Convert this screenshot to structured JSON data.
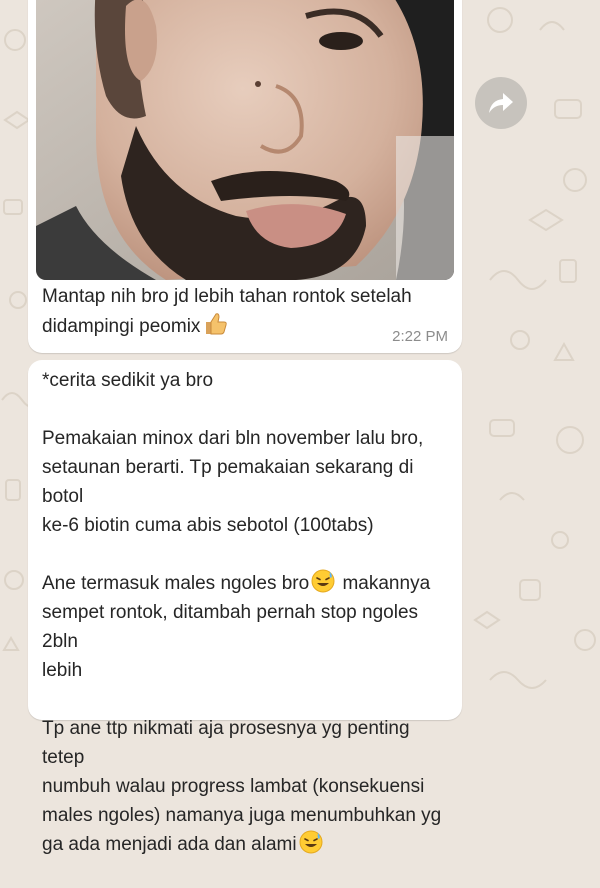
{
  "chat": {
    "wallpaper_color": "#ECE5DD",
    "messages": [
      {
        "type": "image",
        "caption_lines": [
          "Mantap nih bro jd lebih tahan rontok setelah",
          "didampingi peomix"
        ],
        "caption_emoji": "thumbs-up-icon",
        "time": "2:22 PM"
      },
      {
        "type": "text",
        "paragraphs": [
          {
            "lines": [
              "*cerita sedikit ya bro"
            ]
          },
          {
            "lines": [
              "Pemakaian minox dari bln november lalu bro,",
              "setaunan berarti. Tp pemakaian sekarang di botol",
              "ke-6 biotin cuma abis sebotol (100tabs)"
            ]
          },
          {
            "lines": [
              "Ane termasuk males ngoles bro",
              "sempet rontok, ditambah pernah stop ngoles 2bln",
              "lebih"
            ],
            "line1_tail": "makannya",
            "emoji": "grinning-sweat-face-icon"
          },
          {
            "lines": [
              "Tp ane ttp nikmati aja prosesnya yg penting tetep",
              "numbuh walau progress lambat (konsekuensi",
              "males ngoles) namanya juga menumbuhkan yg",
              "ga ada menjadi ada dan alami"
            ],
            "emoji": "grinning-sweat-face-icon"
          }
        ]
      }
    ],
    "forward_icon": "forward-arrow-icon"
  }
}
